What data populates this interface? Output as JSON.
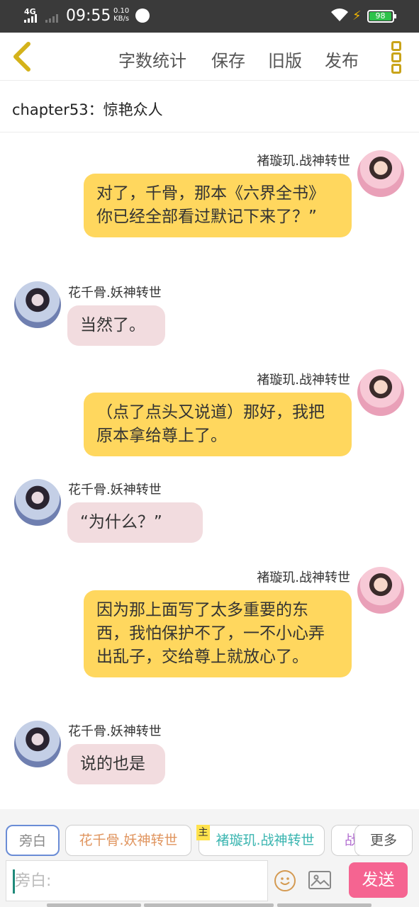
{
  "status": {
    "network": "4G",
    "time": "09:55",
    "speed": "0.10",
    "speed_unit": "KB/s",
    "battery": "98"
  },
  "toolbar": {
    "word_count": "字数统计",
    "save": "保存",
    "old_version": "旧版",
    "publish": "发布"
  },
  "chapter_title": "chapter53：惊艳众人",
  "messages": [
    {
      "speaker": "褚璇玑.战神转世",
      "text": "对了，千骨，那本《六界全书》你已经全部看过默记下来了？”"
    },
    {
      "speaker": "花千骨.妖神转世",
      "text": "当然了。"
    },
    {
      "speaker": "褚璇玑.战神转世",
      "text": "（点了点头又说道）那好，我把原本拿给尊上了。"
    },
    {
      "speaker": "花千骨.妖神转世",
      "text": "“为什么？”"
    },
    {
      "speaker": "褚璇玑.战神转世",
      "text": "因为那上面写了太多重要的东西，我怕保护不了，一不小心弄出乱子，交给尊上就放心了。"
    },
    {
      "speaker": "花千骨.妖神转世",
      "text": "说的也是"
    }
  ],
  "roles": {
    "narration": "旁白",
    "hua": "花千骨.妖神转世",
    "zhu_badge": "主",
    "zhu": "褚璇玑.战神转世",
    "partial": "战",
    "more": "更多"
  },
  "colors": {
    "hua_role": "#e0955f",
    "zhu_role": "#3ab5b0",
    "partial_role": "#b36fd1",
    "send": "#f56491",
    "bubble_right": "#ffd75e",
    "bubble_left": "#f2dcdf"
  },
  "input": {
    "placeholder": "旁白:"
  },
  "send_label": "发送"
}
